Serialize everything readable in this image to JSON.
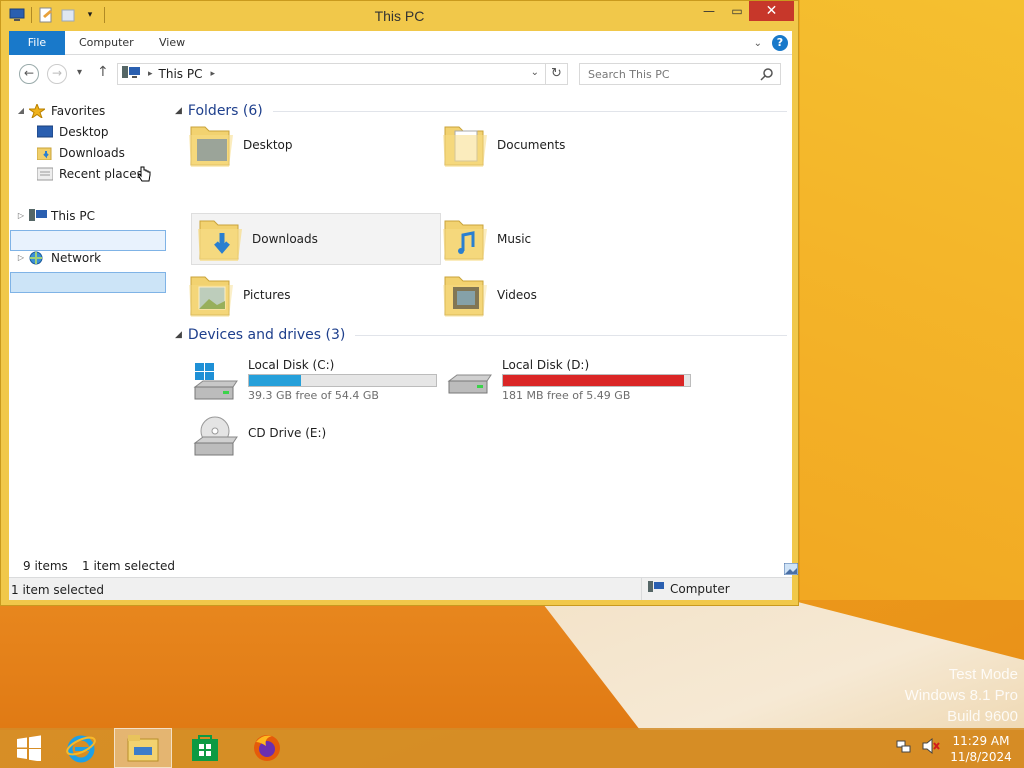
{
  "window": {
    "title": "This PC",
    "ribbon_tabs": [
      "File",
      "Computer",
      "View"
    ],
    "help_label": "?"
  },
  "navbar": {
    "address_crumb": "This PC",
    "search_placeholder": "Search This PC"
  },
  "sidebar": {
    "favorites": "Favorites",
    "desktop": "Desktop",
    "downloads": "Downloads",
    "recent_places": "Recent places",
    "this_pc": "This PC",
    "network": "Network"
  },
  "content": {
    "folders_header": "Folders (6)",
    "folders": [
      "Desktop",
      "Documents",
      "Downloads",
      "Music",
      "Pictures",
      "Videos"
    ],
    "selected_folder": "Downloads",
    "drives_header": "Devices and drives (3)",
    "drives": [
      {
        "name": "Local Disk (C:)",
        "free_text": "39.3 GB free of 54.4 GB",
        "used_fraction": 0.28,
        "bar_color": "#26a0da"
      },
      {
        "name": "Local Disk (D:)",
        "free_text": "181 MB free of 5.49 GB",
        "used_fraction": 0.968,
        "bar_color": "#da2626"
      },
      {
        "name": "CD Drive (E:)"
      }
    ]
  },
  "status": {
    "items_count": "9 items",
    "selected_count": "1 item selected",
    "detail_left": "1 item selected",
    "detail_right": "Computer"
  },
  "desktop": {
    "watermark_line1": "Test Mode",
    "watermark_line2": "Windows 8.1 Pro",
    "watermark_line3": "Build 9600"
  },
  "taskbar": {
    "time": "11:29 AM",
    "date": "11/8/2024"
  },
  "colors": {
    "accent": "#1979ca",
    "window_frame": "#f1c84a",
    "close": "#c7372a"
  }
}
